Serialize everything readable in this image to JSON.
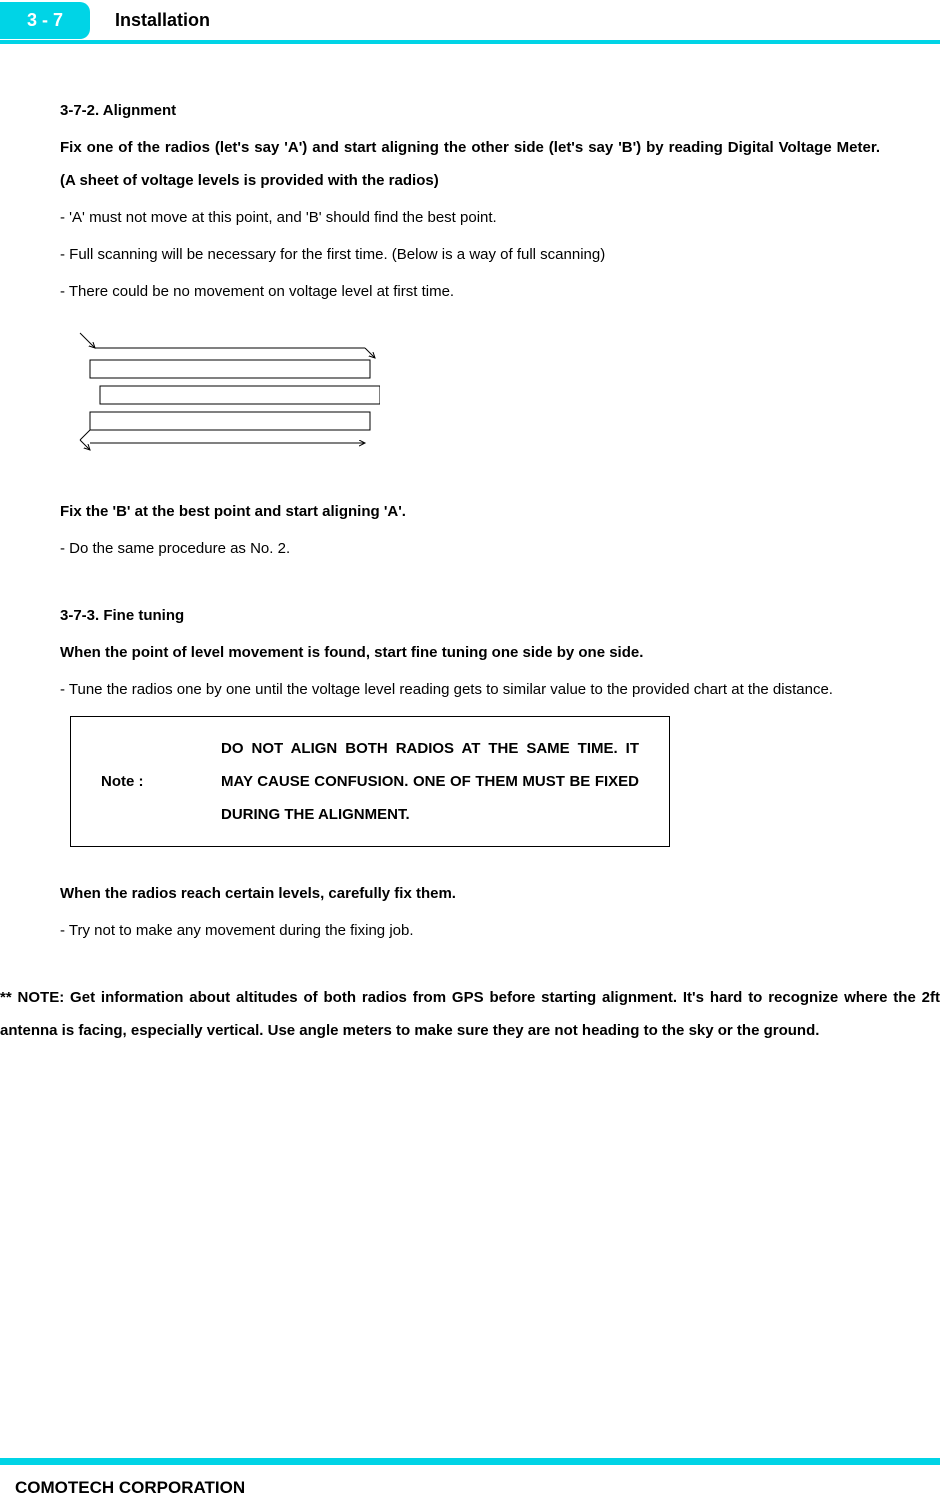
{
  "header": {
    "section_number": "3 - 7",
    "section_title": "Installation"
  },
  "s372": {
    "heading": "3-7-2. Alignment",
    "p1": "Fix one of the radios (let's say 'A') and start aligning the other side (let's say 'B') by reading Digital Voltage Meter. (A sheet of voltage levels is provided with the radios)",
    "p2": "- 'A' must not move at this point, and 'B' should find the best point.",
    "p3": "- Full scanning will be necessary for the first time. (Below is a way of full scanning)",
    "p4": "- There could be no movement on voltage level at first time.",
    "p5": "Fix the 'B' at the best point and start aligning 'A'.",
    "p6": "- Do the same procedure as No. 2."
  },
  "s373": {
    "heading": "3-7-3. Fine tuning",
    "p1": "When the point of level movement is found, start fine tuning one side by one side.",
    "p2": "- Tune the radios one by one until the voltage level reading gets to similar value to the provided chart at the distance.",
    "note_label": "Note :",
    "note_text": "DO NOT ALIGN BOTH RADIOS AT THE SAME TIME. IT MAY CAUSE CONFUSION. ONE OF THEM MUST BE FIXED DURING THE ALIGNMENT.",
    "p3": "When the radios reach certain levels, carefully fix them.",
    "p4": "- Try not to make any movement during the fixing job."
  },
  "footnote": "** NOTE: Get information about altitudes of both radios from GPS before starting alignment. It's hard to recognize where the 2ft antenna is facing, especially vertical. Use angle meters to make sure they are not heading to the sky or the ground.",
  "footer": "COMOTECH CORPORATION"
}
